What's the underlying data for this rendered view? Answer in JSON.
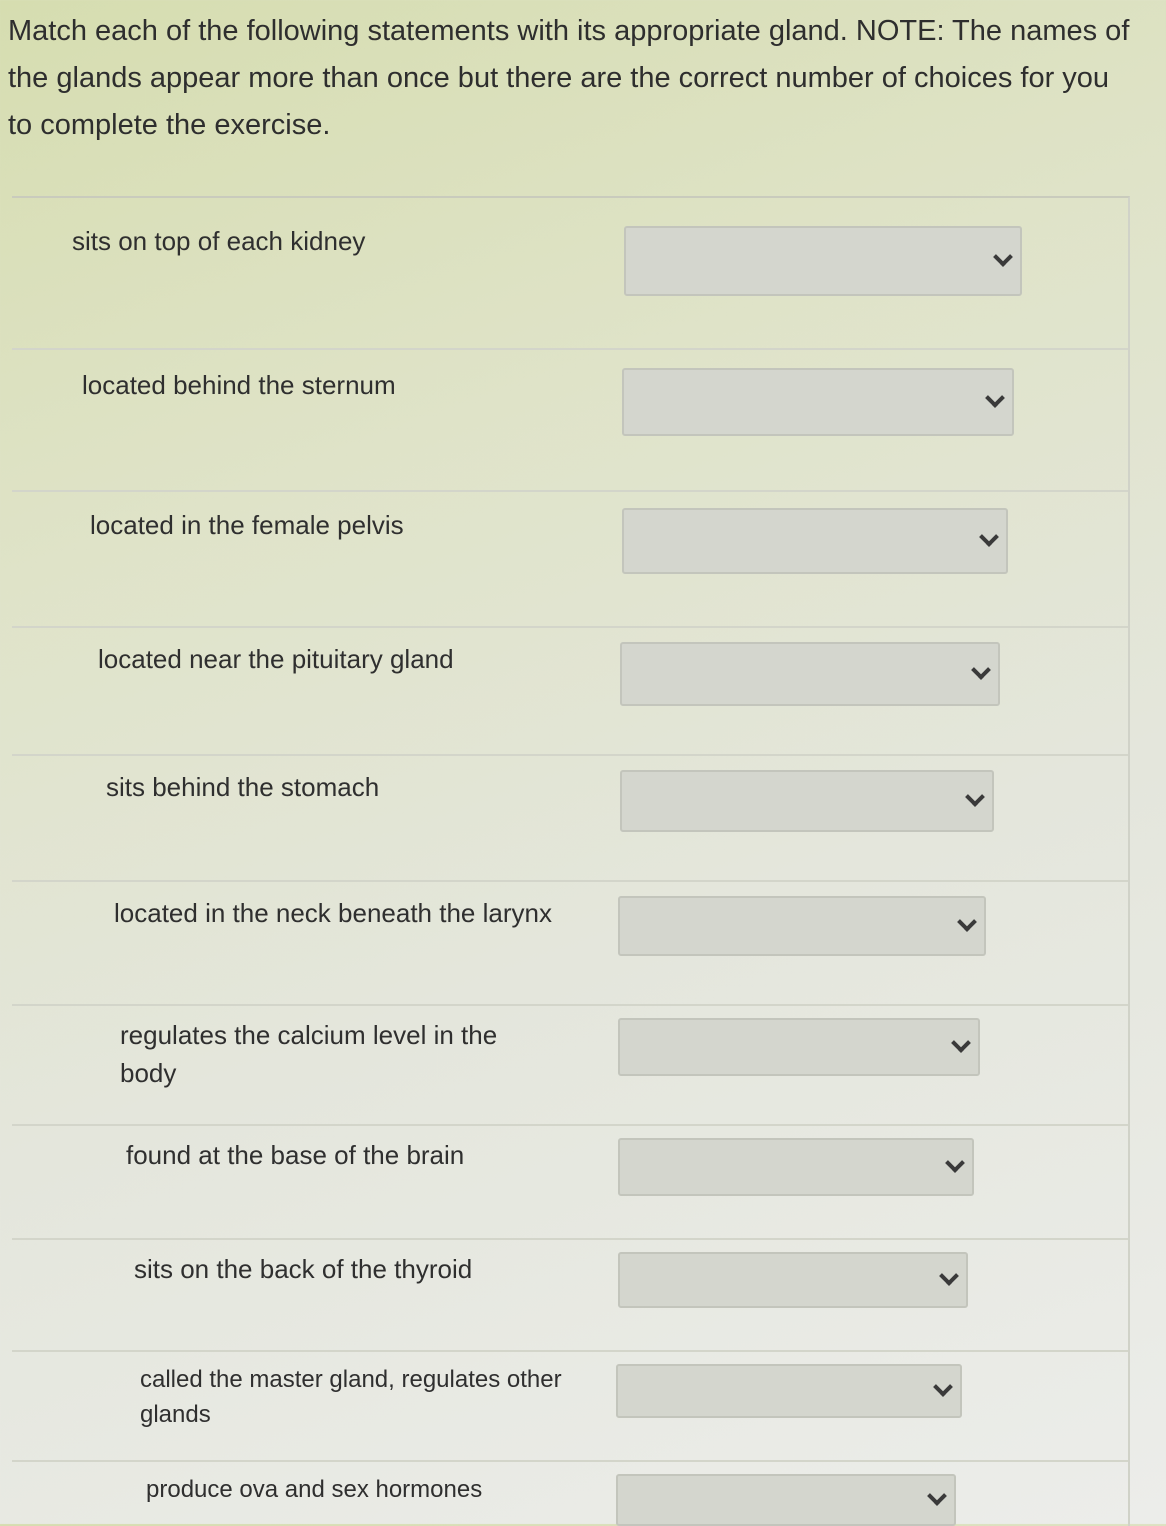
{
  "instructions": "Match each of the following statements with its appropriate gland. NOTE: The names of the glands appear more than once but there are the correct number of choices for you to complete the exercise.",
  "statements": [
    {
      "text": "sits on top of each kidney",
      "selected": ""
    },
    {
      "text": "located behind the sternum",
      "selected": ""
    },
    {
      "text": "located in the female pelvis",
      "selected": ""
    },
    {
      "text": "located near the pituitary gland",
      "selected": ""
    },
    {
      "text": "sits behind the stomach",
      "selected": ""
    },
    {
      "text": "located in the neck beneath the larynx",
      "selected": ""
    },
    {
      "text": "regulates the calcium level in the body",
      "selected": ""
    },
    {
      "text": "found at the base of the brain",
      "selected": ""
    },
    {
      "text": "sits on the back of the thyroid",
      "selected": ""
    },
    {
      "text": "called the master gland, regulates other glands",
      "selected": ""
    },
    {
      "text": "produce ova and sex hormones",
      "selected": ""
    }
  ]
}
